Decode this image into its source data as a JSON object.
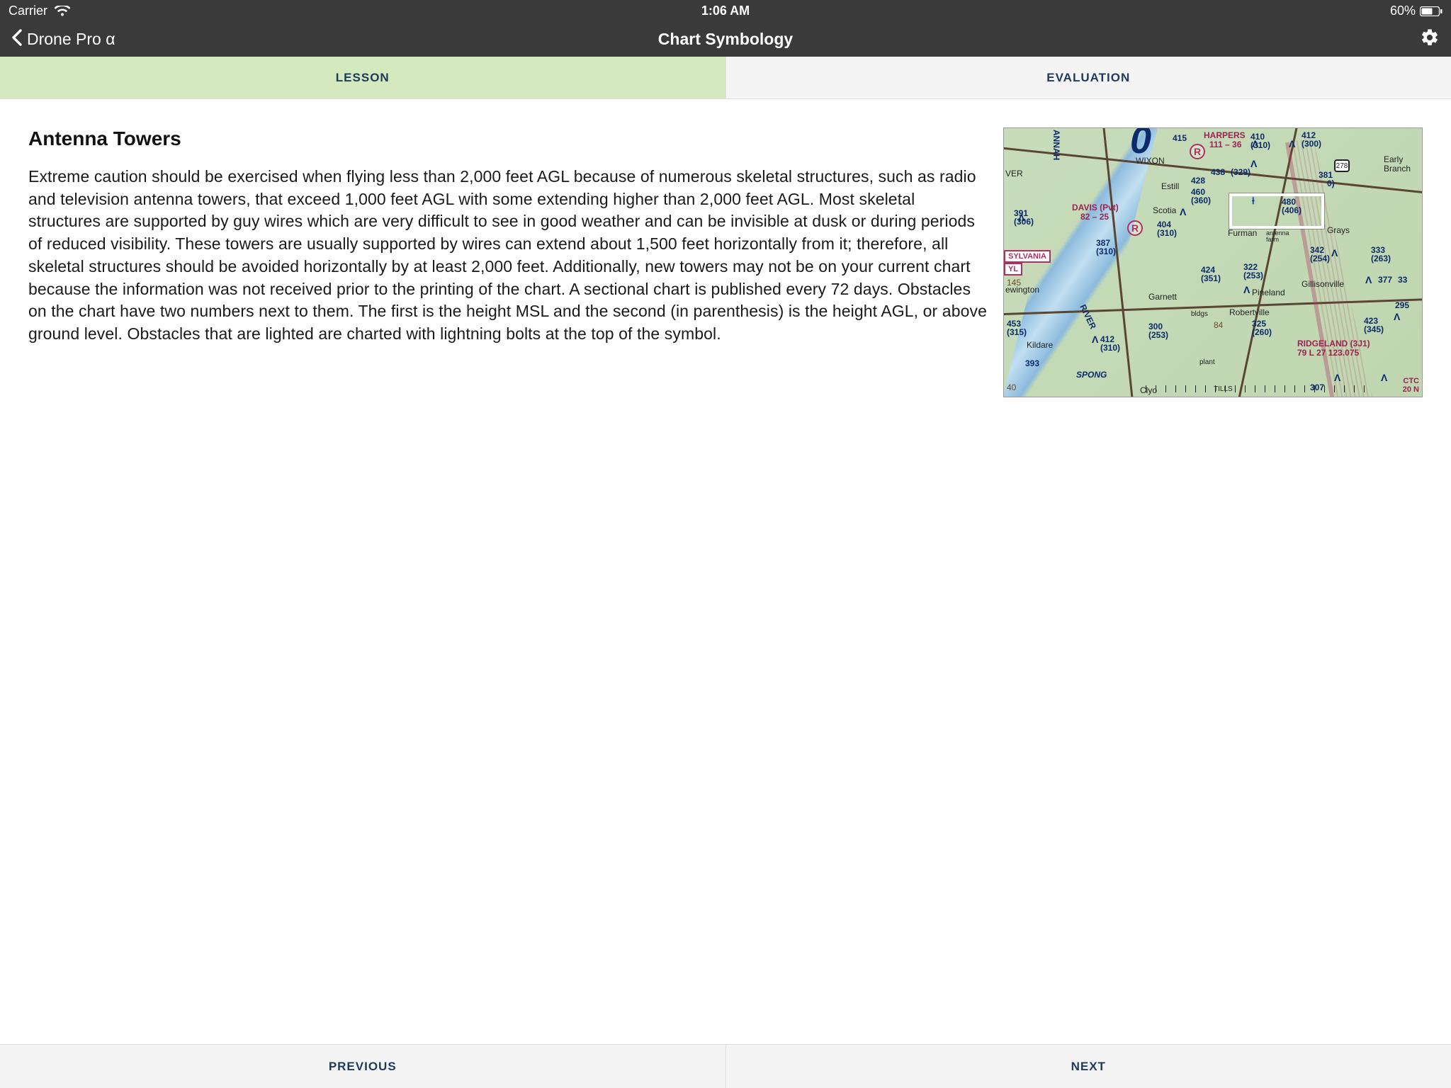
{
  "status_bar": {
    "carrier": "Carrier",
    "time": "1:06 AM",
    "battery_pct": "60%"
  },
  "nav": {
    "back_label": "Drone Pro α",
    "title": "Chart Symbology"
  },
  "tabs": {
    "lesson": "LESSON",
    "evaluation": "EVALUATION"
  },
  "lesson": {
    "heading": "Antenna Towers",
    "body": "Extreme caution should be exercised when flying less than 2,000 feet AGL because of numerous skeletal structures, such as radio and television antenna towers, that exceed 1,000 feet AGL with some extending higher than 2,000 feet AGL. Most skeletal structures are supported by guy wires which are very difficult to see in good weather and can be invisible at dusk or during periods of reduced visibility. These towers are usually supported by wires can extend about 1,500 feet horizontally from it; therefore, all skeletal structures should be avoided horizontally by at least 2,000 feet. Additionally, new towers may not be on your current chart because the information was not received prior to the printing of the chart. A sectional chart is published every 72 days. Obstacles on the chart have two numbers next to them. The first is the height MSL and the second (in parenthesis)  is the height AGL, or above ground level. Obstacles that are lighted are charted with lightning bolts at the top of the symbol."
  },
  "bottom_nav": {
    "prev": "PREVIOUS",
    "next": "NEXT"
  },
  "chart": {
    "big_digit": "0",
    "route_shield": "278",
    "highlight_values": {
      "msl": "480",
      "agl": "(406)"
    },
    "r_glyph": "R",
    "towns": {
      "wixon": "WIXON",
      "estill": "Estill",
      "scotia": "Scotia",
      "furman": "Furman",
      "garnett": "Garnett",
      "pineland": "Pineland",
      "robertville": "Robertville",
      "gillisonville": "Gillisonville",
      "early_branch": "Early\nBranch",
      "grays": "Grays",
      "kildare": "Kildare",
      "clyo": "Clyo",
      "ewington": "ewington",
      "over": "VER",
      "bldgs": "bldgs",
      "plant": "plant",
      "antenna_farm": "antenna\nfarm",
      "tills": "TILLS",
      "annah": "ANNAH",
      "river": "RIVER",
      "spong": "SPONG"
    },
    "airports": {
      "davis": "DAVIS (Pvt)",
      "davis_rwy": "82 – 25",
      "harpers": "HARPERS",
      "harpers_rwy": "111 – 36",
      "ridgeland": "RIDGELAND  (3J1)",
      "ridgeland_line2": "79  L  27  123.075",
      "sylvania": "SYLVANIA",
      "yl": "YL"
    },
    "obstacles": [
      {
        "msl": "415",
        "agl": ""
      },
      {
        "msl": "410",
        "agl": "(310)"
      },
      {
        "msl": "412",
        "agl": "(300)"
      },
      {
        "msl": "438",
        "agl": "(329)"
      },
      {
        "msl": "428",
        "agl": ""
      },
      {
        "msl": "460",
        "agl": "(360)"
      },
      {
        "msl": "480",
        "agl": "(406)"
      },
      {
        "msl": "391",
        "agl": "(306)"
      },
      {
        "msl": "404",
        "agl": "(310)"
      },
      {
        "msl": "387",
        "agl": "(310)"
      },
      {
        "msl": "381",
        "agl": "0)"
      },
      {
        "msl": "342",
        "agl": "(254)"
      },
      {
        "msl": "322",
        "agl": "(253)"
      },
      {
        "msl": "424",
        "agl": "(351)"
      },
      {
        "msl": "333",
        "agl": "(263)"
      },
      {
        "msl": "377",
        "agl": "33"
      },
      {
        "msl": "295",
        "agl": ""
      },
      {
        "msl": "423",
        "agl": "(345)"
      },
      {
        "msl": "325",
        "agl": "(260)"
      },
      {
        "msl": "453",
        "agl": "(315)"
      },
      {
        "msl": "412",
        "agl": "(310)"
      },
      {
        "msl": "300",
        "agl": "(253)"
      },
      {
        "msl": "393",
        "agl": ""
      },
      {
        "msl": "145",
        "agl": ""
      },
      {
        "msl": "40",
        "agl": ""
      },
      {
        "msl": "84",
        "agl": ""
      },
      {
        "msl": "307",
        "agl": ""
      }
    ],
    "misc": {
      "ctc": "CTC",
      "twenty_n": "20 N"
    }
  }
}
